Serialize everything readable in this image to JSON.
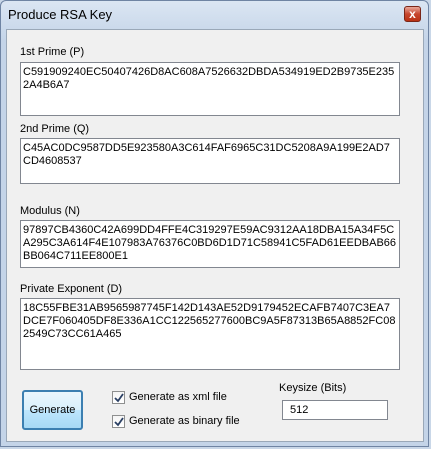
{
  "window": {
    "title": "Produce RSA Key",
    "close_glyph": "x"
  },
  "fields": {
    "prime1": {
      "label": "1st Prime (P)",
      "value": "C591909240EC50407426D8AC608A7526632DBDA534919ED2B9735E2352A4B6A7"
    },
    "prime2": {
      "label": "2nd Prime (Q)",
      "value": "C45AC0DC9587DD5E923580A3C614FAF6965C31DC5208A9A199E2AD7CD4608537"
    },
    "modulus": {
      "label": "Modulus (N)",
      "value": "97897CB4360C42A699DD4FFE4C319297E59AC9312AA18DBA15A34F5CA295C3A614F4E107983A76376C0BD6D1D71C58941C5FAD61EEDBAB66BB064C711EE800E1"
    },
    "private_exponent": {
      "label": "Private Exponent (D)",
      "value": "18C55FBE31AB9565987745F142D143AE52D9179452ECAFB7407C3EA7DCE7F060405DF8E336A1CC122565277600BC9A5F87313B65A8852FC082549C73CC61A465"
    }
  },
  "controls": {
    "generate_label": "Generate",
    "xml_checkbox_label": "Generate as xml file",
    "xml_checked": true,
    "binary_checkbox_label": "Generate as binary file",
    "binary_checked": true,
    "keysize_label": "Keysize (Bits)",
    "keysize_value": "512"
  }
}
